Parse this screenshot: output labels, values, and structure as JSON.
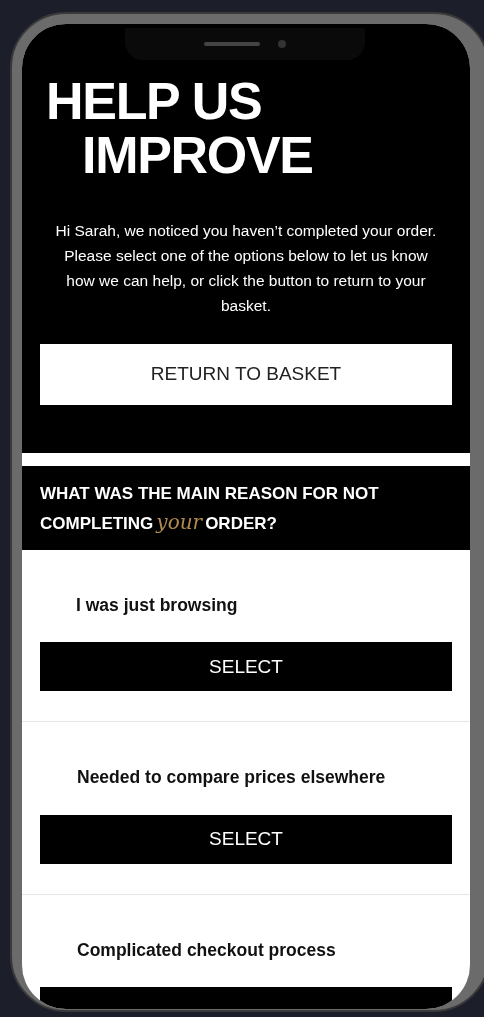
{
  "hero": {
    "title_lines": [
      "HELP US",
      "IMPROVE"
    ],
    "message": "Hi Sarah, we noticed you haven’t completed your order. Please select one of the options below to let us know how we can help, or click the button to return to your basket.",
    "button": "RETURN TO BASKET"
  },
  "question": {
    "before": "WHAT WAS THE MAIN REASON FOR NOT COMPLETING",
    "script_word": "your",
    "after": "ORDER?"
  },
  "options": [
    {
      "label": "I was just browsing",
      "button": "SELECT"
    },
    {
      "label": "Needed to compare prices elsewhere",
      "button": "SELECT"
    },
    {
      "label": "Complicated checkout process"
    }
  ]
}
